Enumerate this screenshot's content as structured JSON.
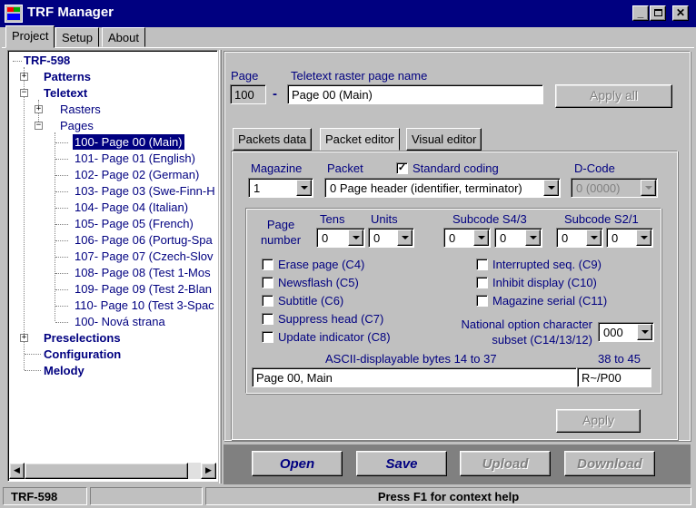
{
  "window": {
    "title": "TRF Manager"
  },
  "tabs": [
    "Project",
    "Setup",
    "About"
  ],
  "tree": {
    "root": "TRF-598",
    "patterns": "Patterns",
    "teletext": "Teletext",
    "rasters": "Rasters",
    "pages": "Pages",
    "page_items": [
      "100- Page 00 (Main)",
      "101- Page 01 (English)",
      "102- Page 02 (German)",
      "103- Page 03 (Swe-Finn-H",
      "104- Page 04 (Italian)",
      "105- Page 05 (French)",
      "106- Page 06 (Portug-Spa",
      "107- Page 07 (Czech-Slov",
      "108- Page 08 (Test 1-Mos",
      "109- Page 09 (Test 2-Blan",
      "110- Page 10 (Test 3-Spac",
      "100- Nová strana"
    ],
    "selected_index": 0,
    "preselections": "Preselections",
    "configuration": "Configuration",
    "melody": "Melody"
  },
  "page_header": {
    "page_label": "Page",
    "page_value": "100",
    "dash": "-",
    "name_label": "Teletext raster page name",
    "name_value": "Page 00 (Main)",
    "apply_all": "Apply all"
  },
  "editor_tabs": [
    "Packets data",
    "Packet editor",
    "Visual editor"
  ],
  "editor": {
    "magazine_label": "Magazine",
    "magazine_value": "1",
    "packet_label": "Packet",
    "standard_coding_label": "Standard coding",
    "standard_coding_checked": true,
    "packet_value": "0 Page header (identifier, terminator)",
    "dcode_label": "D-Code",
    "dcode_value": "0 (0000)",
    "page_number_label": "Page number",
    "tens_label": "Tens",
    "tens_value": "0",
    "units_label": "Units",
    "units_value": "0",
    "s43_label": "Subcode S4/3",
    "s43_values": [
      "0",
      "0"
    ],
    "s21_label": "Subcode S2/1",
    "s21_values": [
      "0",
      "0"
    ],
    "left_checks": [
      {
        "label": "Erase page (C4)",
        "checked": false
      },
      {
        "label": "Newsflash (C5)",
        "checked": false
      },
      {
        "label": "Subtitle (C6)",
        "checked": false
      },
      {
        "label": "Suppress head (C7)",
        "checked": false
      },
      {
        "label": "Update indicator (C8)",
        "checked": false
      }
    ],
    "right_checks": [
      {
        "label": "Interrupted seq. (C9)",
        "checked": false
      },
      {
        "label": "Inhibit display (C10)",
        "checked": false
      },
      {
        "label": "Magazine serial (C11)",
        "checked": false
      }
    ],
    "national_label": "National option character subset (C14/13/12)",
    "national_value": "000",
    "ascii_label": "ASCII-displayable bytes 14 to 37",
    "ascii_value": "Page 00, Main",
    "bytes_label": "38 to 45",
    "bytes_value": "R~/P00",
    "apply": "Apply"
  },
  "actions": [
    "Open",
    "Save",
    "Upload",
    "Download"
  ],
  "status": {
    "left": "TRF-598",
    "right": "Press F1 for context help"
  }
}
